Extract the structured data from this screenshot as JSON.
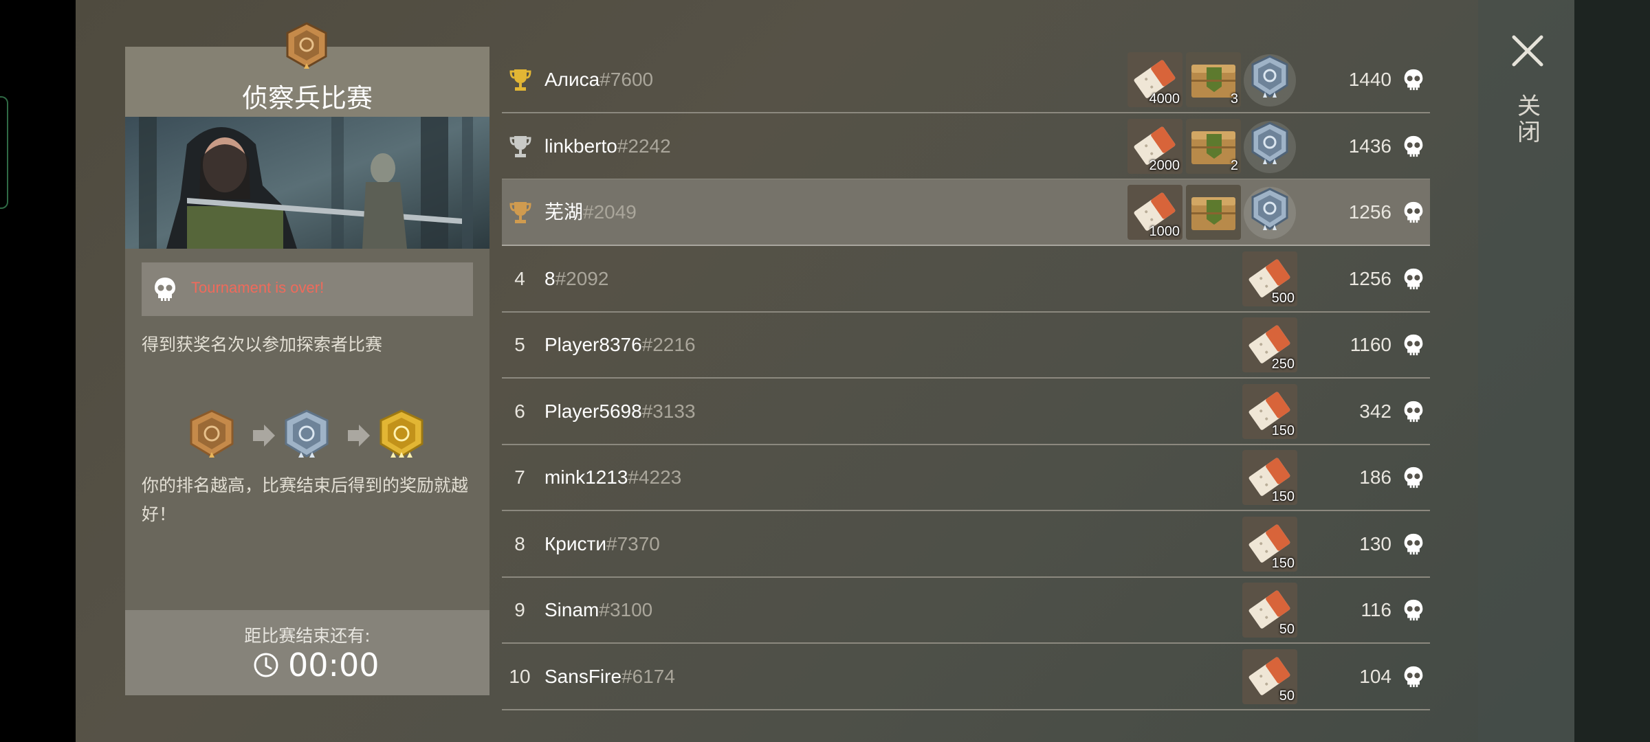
{
  "panel": {
    "title": "侦察兵比赛",
    "status_message": "Tournament is over!",
    "description": "得到获奖名次以参加探索者比赛",
    "rank_hint": "你的排名越高，比赛结束后得到的奖励就越好！",
    "remaining_label": "距比赛结束还有:",
    "timer": "00:00"
  },
  "close": {
    "label": "关闭"
  },
  "colors": {
    "status_red": "#f06a5b",
    "gold": "#e2b634",
    "silver": "#c9cac7",
    "bronze": "#d09b4f"
  },
  "leaderboard": [
    {
      "rank": "",
      "trophy": "gold",
      "name": "Алиса",
      "tag": "#7600",
      "score": "1440",
      "rewards": [
        "4000",
        "3"
      ],
      "medal": true,
      "highlight": false
    },
    {
      "rank": "",
      "trophy": "silver",
      "name": "linkberto",
      "tag": "#2242",
      "score": "1436",
      "rewards": [
        "2000",
        "2"
      ],
      "medal": true,
      "highlight": false
    },
    {
      "rank": "",
      "trophy": "bronze",
      "name": "芜湖",
      "tag": "#2049",
      "score": "1256",
      "rewards": [
        "1000",
        ""
      ],
      "medal": true,
      "highlight": true
    },
    {
      "rank": "4",
      "trophy": "",
      "name": "8",
      "tag": "#2092",
      "score": "1256",
      "rewards": [
        "500"
      ],
      "medal": false,
      "highlight": false
    },
    {
      "rank": "5",
      "trophy": "",
      "name": "Player8376",
      "tag": "#2216",
      "score": "1160",
      "rewards": [
        "250"
      ],
      "medal": false,
      "highlight": false
    },
    {
      "rank": "6",
      "trophy": "",
      "name": "Player5698",
      "tag": "#3133",
      "score": "342",
      "rewards": [
        "150"
      ],
      "medal": false,
      "highlight": false
    },
    {
      "rank": "7",
      "trophy": "",
      "name": "mink1213",
      "tag": "#4223",
      "score": "186",
      "rewards": [
        "150"
      ],
      "medal": false,
      "highlight": false
    },
    {
      "rank": "8",
      "trophy": "",
      "name": "Кристи",
      "tag": "#7370",
      "score": "130",
      "rewards": [
        "150"
      ],
      "medal": false,
      "highlight": false
    },
    {
      "rank": "9",
      "trophy": "",
      "name": "Sinam",
      "tag": "#3100",
      "score": "116",
      "rewards": [
        "50"
      ],
      "medal": false,
      "highlight": false
    },
    {
      "rank": "10",
      "trophy": "",
      "name": "SansFire",
      "tag": "#6174",
      "score": "104",
      "rewards": [
        "50"
      ],
      "medal": false,
      "highlight": false
    }
  ]
}
